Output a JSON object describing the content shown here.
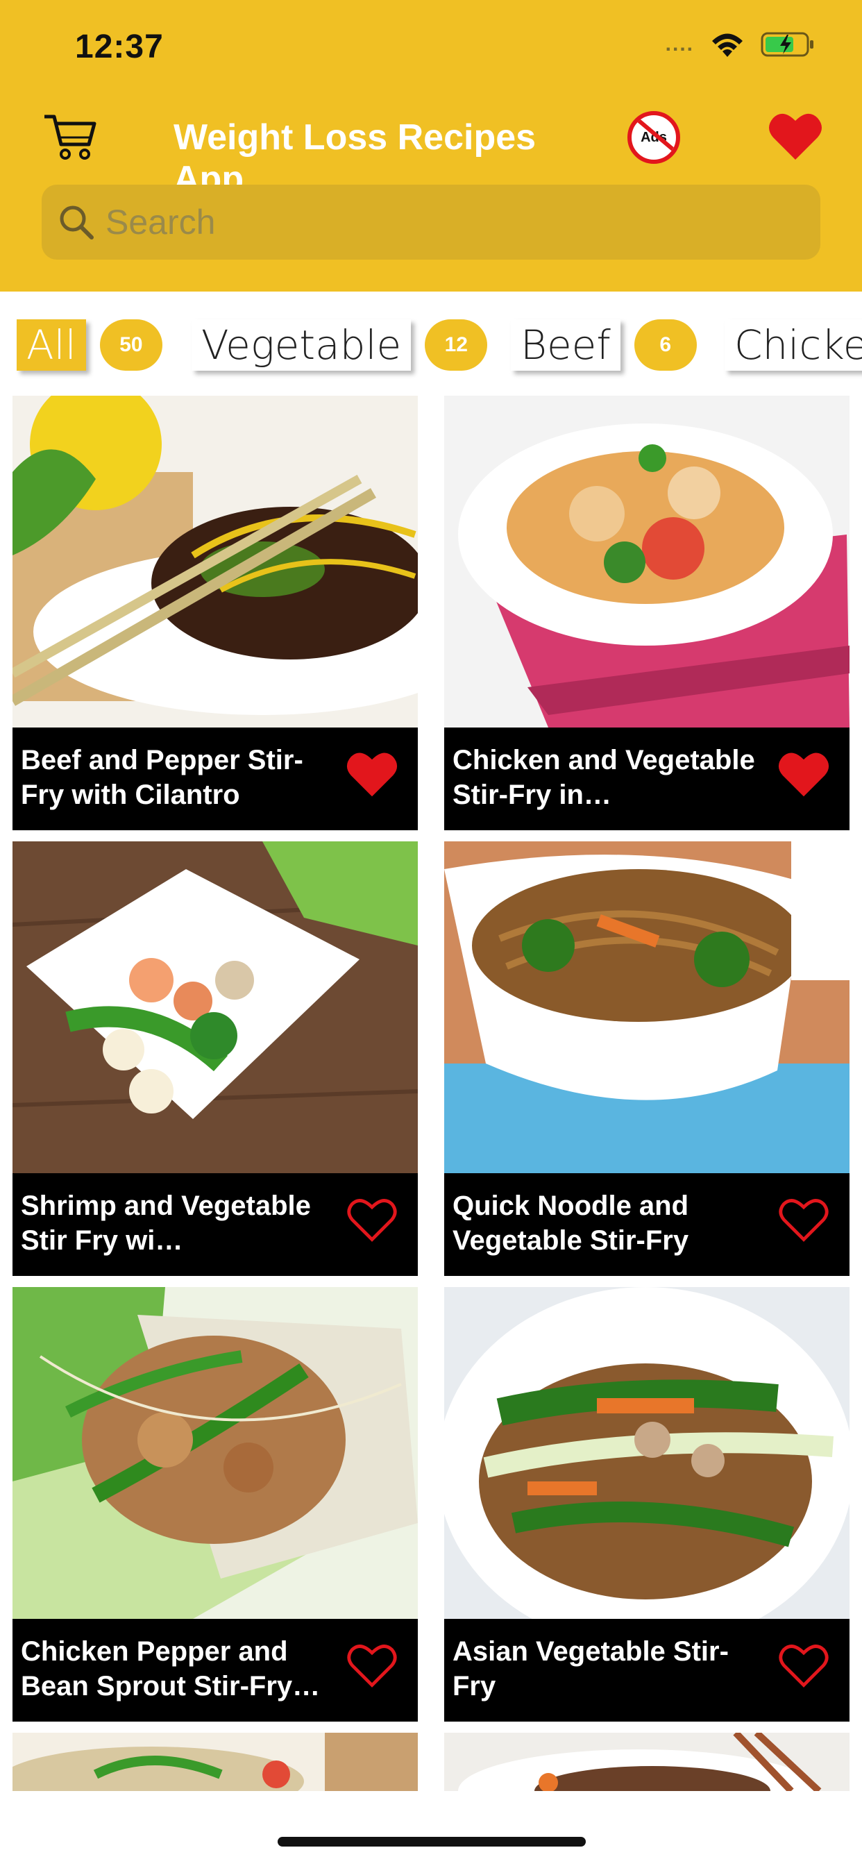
{
  "status_bar": {
    "time": "12:37",
    "signal": "....",
    "colors": {
      "battery_fill": "#38c94a"
    }
  },
  "header": {
    "title": "Weight Loss Recipes App",
    "no_ads_label": "Ads",
    "background": "#F0C024"
  },
  "search": {
    "placeholder": "Search"
  },
  "categories": [
    {
      "label": "All",
      "count": "50",
      "active": true
    },
    {
      "label": "Vegetable",
      "count": "12",
      "active": false
    },
    {
      "label": "Beef",
      "count": "6",
      "active": false
    },
    {
      "label": "Chicken",
      "count": "",
      "active": false
    }
  ],
  "recipes": [
    {
      "title": "Beef and Pepper Stir-Fry with Cilantro",
      "favorite": true
    },
    {
      "title": "Chicken and Vegetable Stir-Fry in…",
      "favorite": true
    },
    {
      "title": "Shrimp and Vegetable Stir Fry wi…",
      "favorite": false
    },
    {
      "title": "Quick Noodle and Vegetable Stir-Fry",
      "favorite": false
    },
    {
      "title": "Chicken Pepper and Bean Sprout Stir-Fry…",
      "favorite": false
    },
    {
      "title": "Asian Vegetable Stir-Fry",
      "favorite": false
    }
  ],
  "icons": {
    "cart": "cart-icon",
    "no_ads": "no-ads-icon",
    "favorites": "heart-icon",
    "search": "search-icon"
  }
}
